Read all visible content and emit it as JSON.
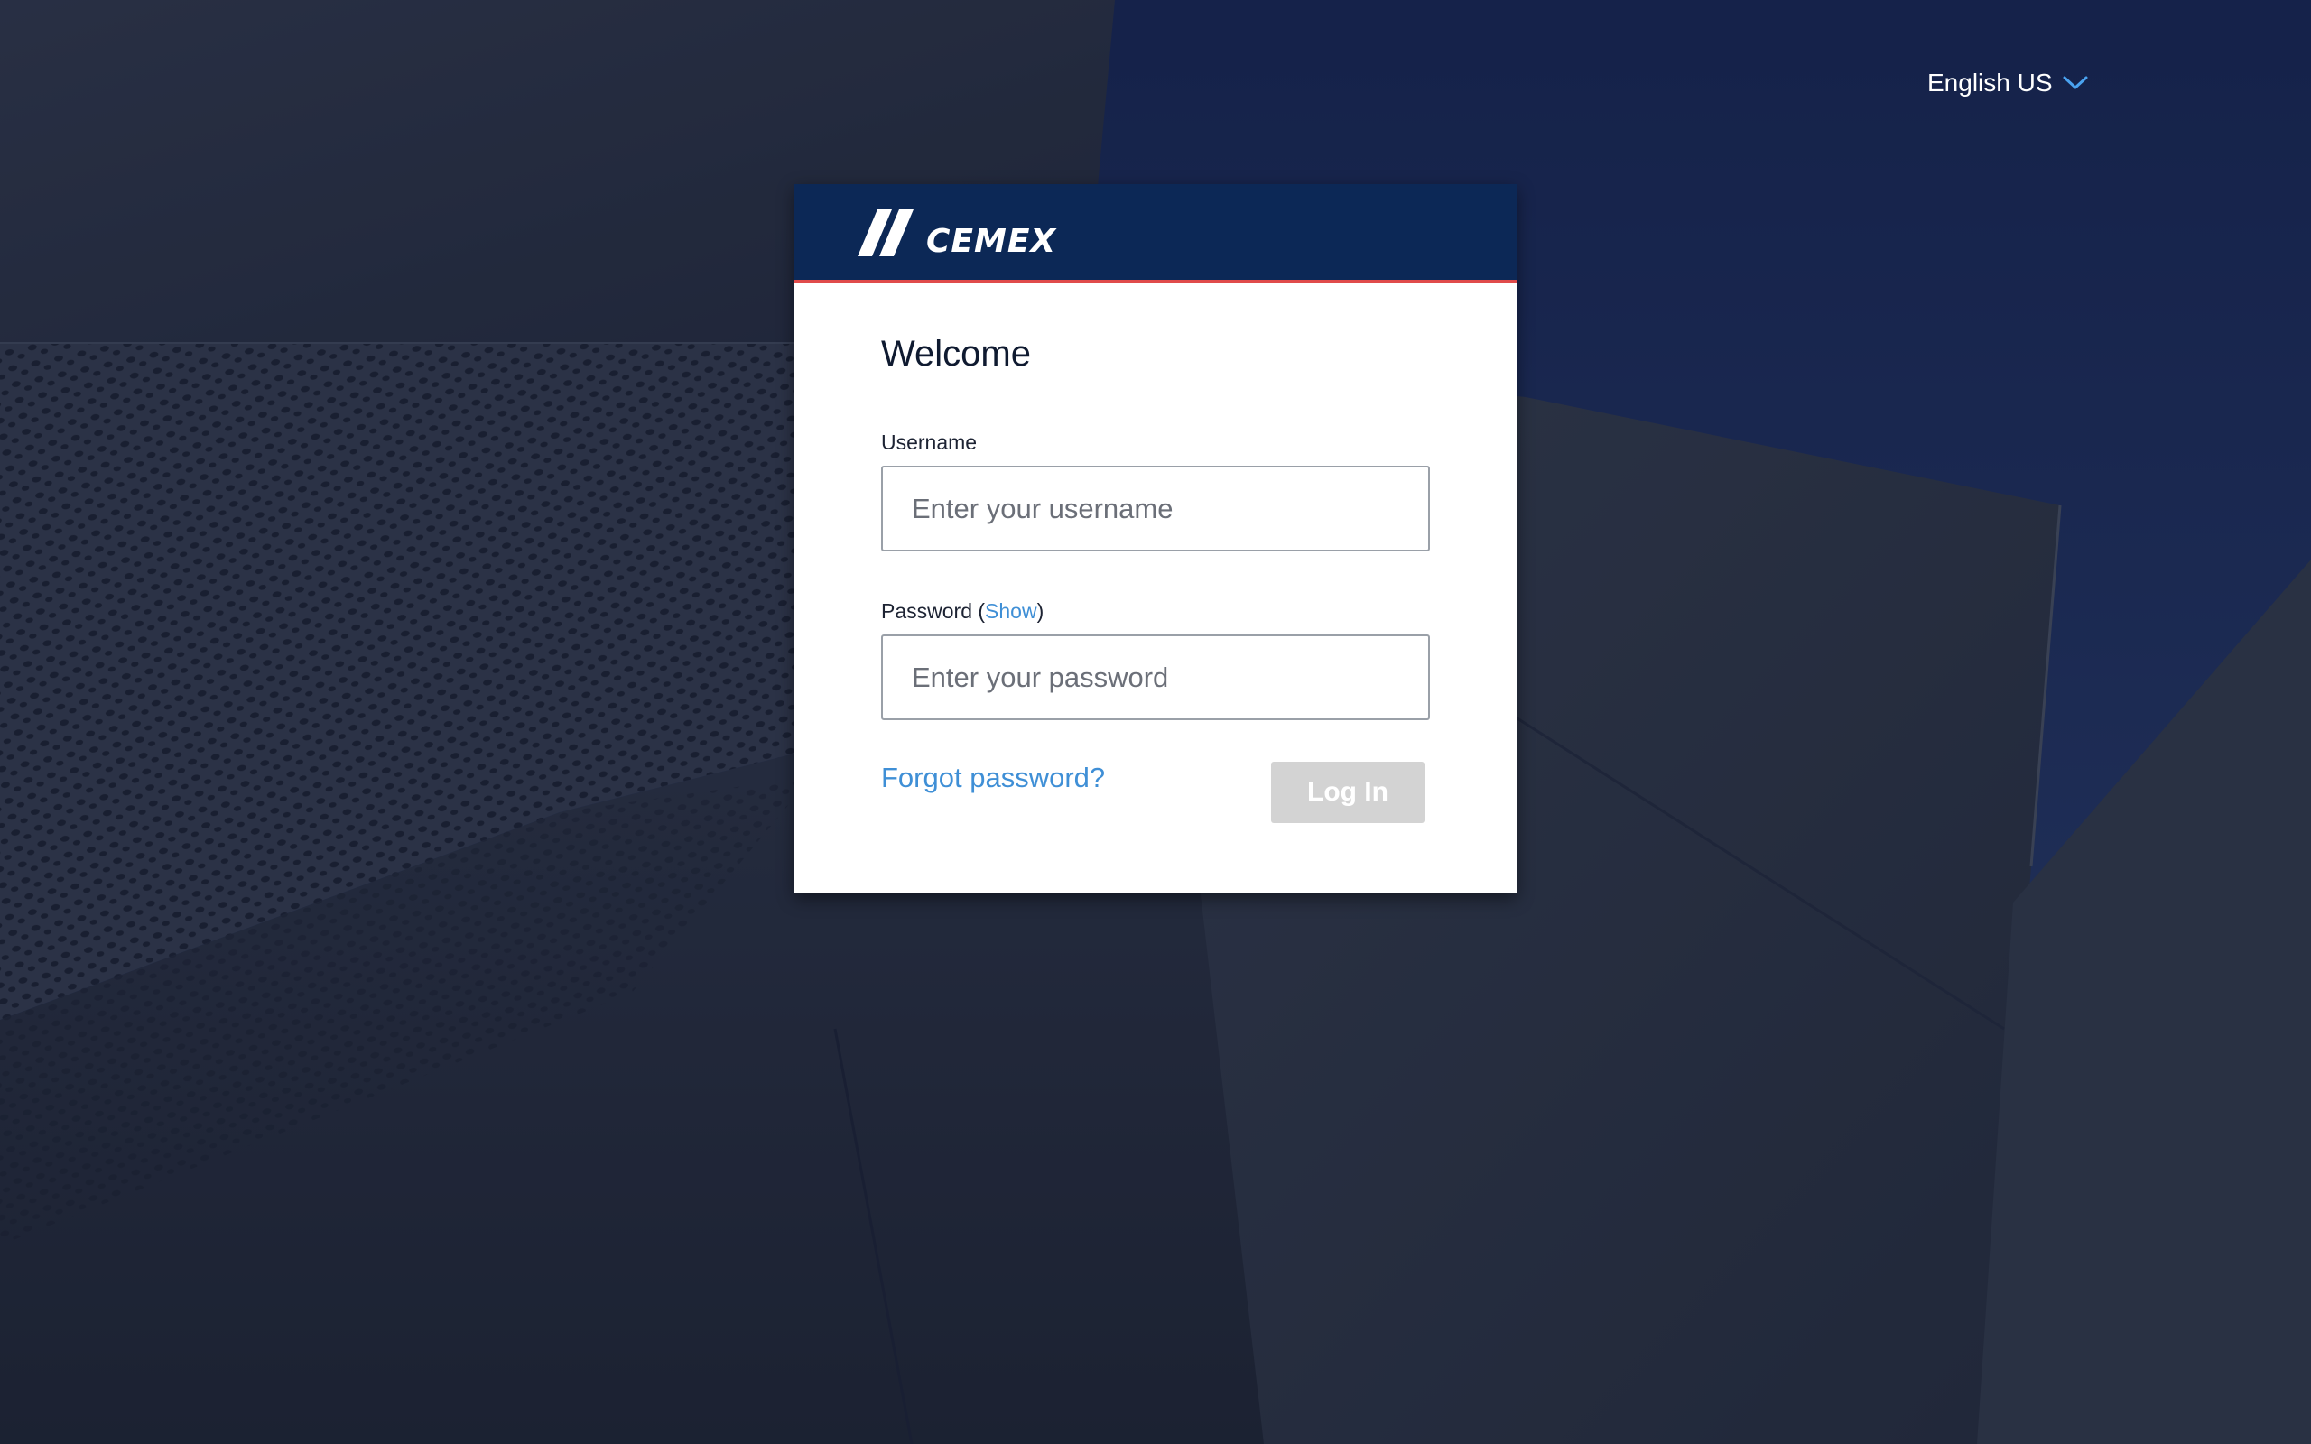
{
  "language": {
    "label": "English US",
    "icon": "chevron-down-icon",
    "accent": "#4aa3f0"
  },
  "brand": {
    "name": "CEMEX",
    "header_color": "#0c2856",
    "stripe_color": "#e04b4b"
  },
  "login": {
    "title": "Welcome",
    "username_label": "Username",
    "username_placeholder": "Enter your username",
    "password_label": "Password (",
    "password_show": "Show",
    "password_label_close": ")",
    "password_placeholder": "Enter your password",
    "forgot_link": "Forgot password?",
    "login_button": "Log In",
    "link_color": "#3f8fd6",
    "button_disabled_color": "#d3d3d3"
  }
}
